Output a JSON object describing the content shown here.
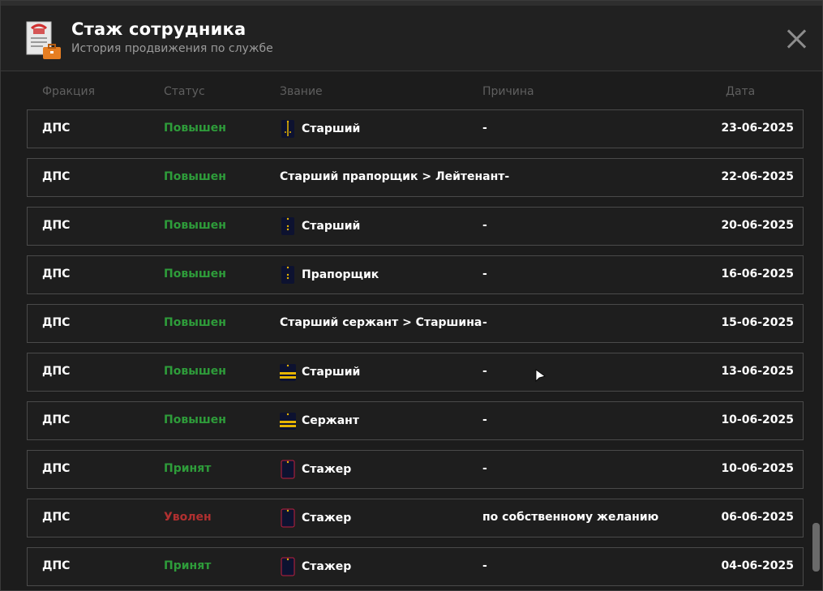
{
  "header": {
    "title": "Стаж сотрудника",
    "subtitle": "История продвижения по службе"
  },
  "columns": {
    "faction": "Фракция",
    "status": "Статус",
    "rank": "Звание",
    "reason": "Причина",
    "date": "Дата"
  },
  "rows": [
    {
      "faction": "ДПС",
      "status": "Повышен",
      "status_color": "green",
      "rank_icon": "epaulette-stripe-icon",
      "rank": "Старший",
      "reason": "-",
      "date": "23-06-2025"
    },
    {
      "faction": "ДПС",
      "status": "Повышен",
      "status_color": "green",
      "rank_icon": "",
      "rank": "Старший прапорщик > Лейтенант-",
      "reason": "",
      "date": "22-06-2025"
    },
    {
      "faction": "ДПС",
      "status": "Повышен",
      "status_color": "green",
      "rank_icon": "epaulette-stars-icon",
      "rank": "Старший",
      "reason": "-",
      "date": "20-06-2025"
    },
    {
      "faction": "ДПС",
      "status": "Повышен",
      "status_color": "green",
      "rank_icon": "epaulette-stars-icon",
      "rank": "Прапорщик",
      "reason": "-",
      "date": "16-06-2025"
    },
    {
      "faction": "ДПС",
      "status": "Повышен",
      "status_color": "green",
      "rank_icon": "",
      "rank": "Старший сержант > Старшина",
      "reason": "-",
      "date": "15-06-2025"
    },
    {
      "faction": "ДПС",
      "status": "Повышен",
      "status_color": "green",
      "rank_icon": "epaulette-bars-icon",
      "rank": "Старший",
      "reason": "-",
      "date": "13-06-2025"
    },
    {
      "faction": "ДПС",
      "status": "Повышен",
      "status_color": "green",
      "rank_icon": "epaulette-bars-icon",
      "rank": "Сержант",
      "reason": "-",
      "date": "10-06-2025"
    },
    {
      "faction": "ДПС",
      "status": "Принят",
      "status_color": "green",
      "rank_icon": "epaulette-plain-icon",
      "rank": "Стажер",
      "reason": "-",
      "date": "10-06-2025"
    },
    {
      "faction": "ДПС",
      "status": "Уволен",
      "status_color": "red",
      "rank_icon": "epaulette-plain-icon",
      "rank": "Стажер",
      "reason": "по собственному желанию",
      "date": "06-06-2025"
    },
    {
      "faction": "ДПС",
      "status": "Принят",
      "status_color": "green",
      "rank_icon": "epaulette-plain-icon",
      "rank": "Стажер",
      "reason": "-",
      "date": "04-06-2025"
    }
  ],
  "colors": {
    "green": "#2e9c3a",
    "red": "#b03030",
    "epaulette_navy": "#0d1230",
    "epaulette_gold": "#e6b400",
    "epaulette_red_edge": "#c02040"
  }
}
